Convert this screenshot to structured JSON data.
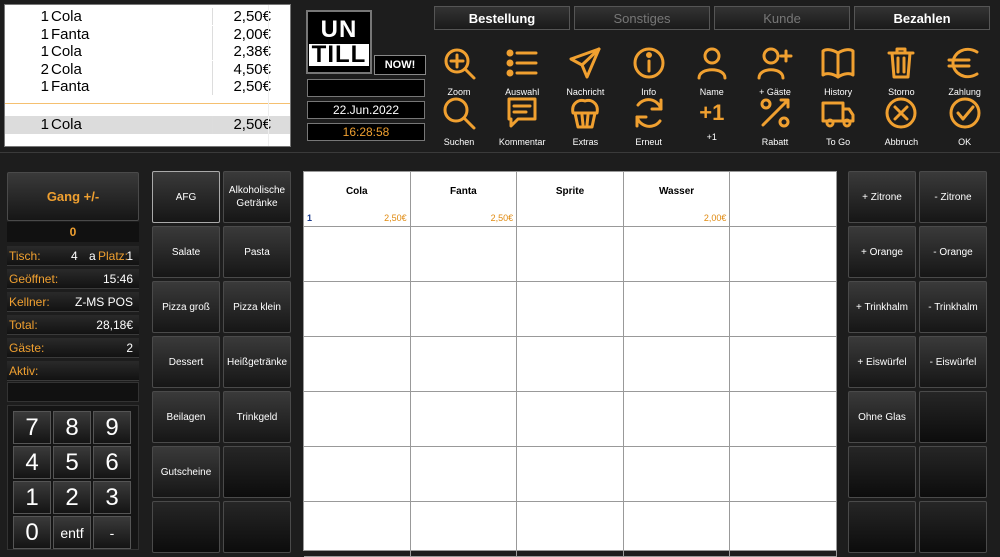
{
  "order": [
    {
      "qty": "1",
      "name": "Cola",
      "price": "2,50€"
    },
    {
      "qty": "1",
      "name": "Fanta",
      "price": "2,00€"
    },
    {
      "qty": "1",
      "name": "Cola",
      "price": "2,38€"
    },
    {
      "qty": "2",
      "name": "Cola",
      "price": "4,50€"
    },
    {
      "qty": "1",
      "name": "Fanta",
      "price": "2,50€"
    }
  ],
  "selected": {
    "qty": "1",
    "name": "Cola",
    "price": "2,50€"
  },
  "logo": {
    "line1": "UN",
    "line2": "TILL",
    "badge": "NOW!"
  },
  "date": "22.Jun.2022",
  "time": "16:28:58",
  "tabs": [
    "Bestellung",
    "Sonstiges",
    "Kunde",
    "Bezahlen"
  ],
  "tools_row1": [
    {
      "label": "Zoom",
      "icon": "zoom-in-icon"
    },
    {
      "label": "Auswahl",
      "icon": "list-icon"
    },
    {
      "label": "Nachricht",
      "icon": "send-icon"
    },
    {
      "label": "Info",
      "icon": "info-icon"
    },
    {
      "label": "Name",
      "icon": "user-icon"
    },
    {
      "label": "+ Gäste",
      "icon": "user-plus-icon"
    },
    {
      "label": "History",
      "icon": "book-icon"
    },
    {
      "label": "Storno",
      "icon": "trash-icon"
    },
    {
      "label": "Zahlung",
      "icon": "euro-icon"
    }
  ],
  "tools_row2": [
    {
      "label": "Suchen",
      "icon": "search-icon"
    },
    {
      "label": "Kommentar",
      "icon": "comment-icon"
    },
    {
      "label": "Extras",
      "icon": "muffin-icon"
    },
    {
      "label": "Erneut",
      "icon": "refresh-icon"
    },
    {
      "label": "+1",
      "icon": "plus-one-icon",
      "glyph": "+1"
    },
    {
      "label": "Rabatt",
      "icon": "percent-icon"
    },
    {
      "label": "To Go",
      "icon": "truck-icon"
    },
    {
      "label": "Abbruch",
      "icon": "cancel-icon"
    },
    {
      "label": "OK",
      "icon": "check-icon"
    }
  ],
  "gang": {
    "label": "Gang +/-",
    "value": "0"
  },
  "info_fields": [
    {
      "key": "Tisch:",
      "value": "1",
      "mid": "4",
      "mid_extra": "a",
      "mid_label": "Platz:"
    },
    {
      "key": "Geöffnet:",
      "value": "15:46"
    },
    {
      "key": "Kellner:",
      "value": "Z-MS POS"
    },
    {
      "key": "Total:",
      "value": "28,18€"
    },
    {
      "key": "Gäste:",
      "value": "2"
    },
    {
      "key": "Aktiv:",
      "value": ""
    }
  ],
  "numpad": [
    "7",
    "8",
    "9",
    "4",
    "5",
    "6",
    "1",
    "2",
    "3",
    "0",
    "entf",
    "-"
  ],
  "categories": [
    [
      "AFG",
      "Alkoholische Getränke"
    ],
    [
      "Salate",
      "Pasta"
    ],
    [
      "Pizza groß",
      "Pizza klein"
    ],
    [
      "Dessert",
      "Heißgetränke"
    ],
    [
      "Beilagen",
      "Trinkgeld"
    ],
    [
      "Gutscheine",
      ""
    ],
    [
      "",
      ""
    ]
  ],
  "products": [
    {
      "name": "Cola",
      "qty": "1",
      "price": "2,50€"
    },
    {
      "name": "Fanta",
      "qty": "",
      "price": "2,50€"
    },
    {
      "name": "Sprite",
      "qty": "",
      "price": ""
    },
    {
      "name": "Wasser",
      "qty": "",
      "price": "2,00€"
    }
  ],
  "modifiers": [
    [
      "+ Zitrone",
      "- Zitrone"
    ],
    [
      "+ Orange",
      "- Orange"
    ],
    [
      "+ Trinkhalm",
      "- Trinkhalm"
    ],
    [
      "+ Eiswürfel",
      "- Eiswürfel"
    ],
    [
      "Ohne Glas",
      ""
    ],
    [
      "",
      ""
    ],
    [
      "",
      ""
    ]
  ],
  "colors": {
    "accent": "#f0a030",
    "background": "#1d1d1d"
  }
}
